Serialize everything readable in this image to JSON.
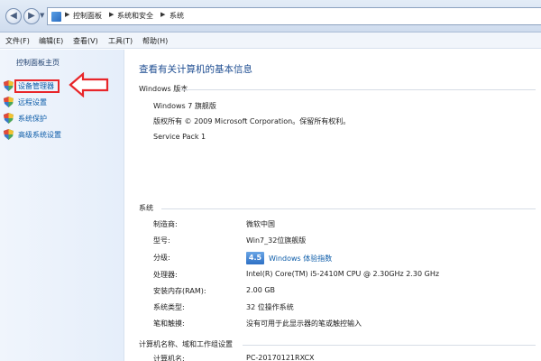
{
  "address_bar": {
    "crumbs": [
      "控制面板",
      "系统和安全",
      "系统"
    ]
  },
  "menu": {
    "items": [
      "文件(F)",
      "编辑(E)",
      "查看(V)",
      "工具(T)",
      "帮助(H)"
    ]
  },
  "sidebar": {
    "home_label": "控制面板主页",
    "items": [
      {
        "label": "设备管理器",
        "icon": "shield-icon"
      },
      {
        "label": "远程设置",
        "icon": "shield-icon"
      },
      {
        "label": "系统保护",
        "icon": "shield-icon"
      },
      {
        "label": "高级系统设置",
        "icon": "shield-icon"
      }
    ]
  },
  "main": {
    "title": "查看有关计算机的基本信息",
    "windows_section": {
      "heading": "Windows 版本",
      "edition": "Windows 7 旗舰版",
      "copyright": "版权所有 © 2009 Microsoft Corporation。保留所有权利。",
      "service_pack": "Service Pack 1"
    },
    "system_section": {
      "heading": "系统",
      "rows": [
        {
          "label": "制造商:",
          "value": "微软中国"
        },
        {
          "label": "型号:",
          "value": "Win7_32位旗舰版"
        },
        {
          "label": "分级:",
          "value": ""
        },
        {
          "label": "处理器:",
          "value": "Intel(R) Core(TM) i5-2410M CPU @ 2.30GHz   2.30 GHz"
        },
        {
          "label": "安装内存(RAM):",
          "value": "2.00 GB"
        },
        {
          "label": "系统类型:",
          "value": "32 位操作系统"
        },
        {
          "label": "笔和触摸:",
          "value": "没有可用于此显示器的笔或触控输入"
        }
      ],
      "rating_score": "4.5",
      "rating_link": "Windows 体验指数"
    },
    "computer_section": {
      "heading": "计算机名称、域和工作组设置",
      "rows": [
        {
          "label": "计算机名:",
          "value": "PC-20170121RXCX"
        }
      ]
    }
  },
  "colors": {
    "link": "#0b5ba8",
    "title": "#1f4e92",
    "highlight_red": "#e8262a"
  }
}
